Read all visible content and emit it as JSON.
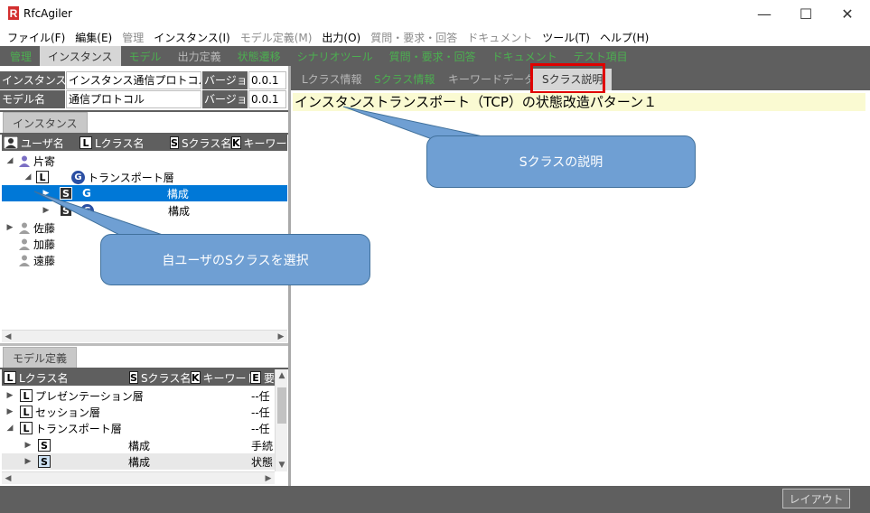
{
  "app": {
    "title": "RfcAgiler",
    "logo_letter": "R"
  },
  "window_controls": {
    "minimize": "—",
    "maximize": "☐",
    "close": "✕"
  },
  "menu": [
    {
      "label": "ファイル(F)",
      "enabled": true
    },
    {
      "label": "編集(E)",
      "enabled": true
    },
    {
      "label": "管理",
      "enabled": false
    },
    {
      "label": "インスタンス(I)",
      "enabled": true
    },
    {
      "label": "モデル定義(M)",
      "enabled": false
    },
    {
      "label": "出力(O)",
      "enabled": true
    },
    {
      "label": "質問・要求・回答",
      "enabled": false
    },
    {
      "label": "ドキュメント",
      "enabled": false
    },
    {
      "label": "ツール(T)",
      "enabled": true
    },
    {
      "label": "ヘルプ(H)",
      "enabled": true
    }
  ],
  "function_tabs": [
    {
      "label": "管理",
      "state": "green"
    },
    {
      "label": "インスタンス",
      "state": "active"
    },
    {
      "label": "モデル",
      "state": "green"
    },
    {
      "label": "出力定義",
      "state": "gray"
    },
    {
      "label": "状態遷移",
      "state": "green"
    },
    {
      "label": "シナリオツール",
      "state": "green"
    },
    {
      "label": "質問・要求・回答",
      "state": "green"
    },
    {
      "label": "ドキュメント",
      "state": "green"
    },
    {
      "label": "テスト項目",
      "state": "green"
    }
  ],
  "instance_form": {
    "instance_label": "インスタンス名",
    "instance_value": "インスタンス通信プロトコル",
    "model_label": "モデル名",
    "model_value": "通信プロトコル",
    "version_label": "バージョン",
    "instance_version": "0.0.1",
    "model_version": "0.0.1"
  },
  "instance_panel": {
    "tab_label": "インスタンス",
    "columns": [
      {
        "badge": "user",
        "label": "ユーザ名"
      },
      {
        "badge": "L",
        "label": "Lクラス名"
      },
      {
        "badge": "S",
        "label": "Sクラス名"
      },
      {
        "badge": "K",
        "label": "キーワード"
      }
    ],
    "tree": {
      "user_katayose": "片寄",
      "l_badge": "L",
      "g_badge": "G",
      "transport_layer": "トランスポート層",
      "s_badge": "S",
      "config": "構成",
      "user_sato": "佐藤",
      "user_kato": "加藤",
      "user_endo": "遠藤"
    }
  },
  "model_panel": {
    "tab_label": "モデル定義",
    "columns": [
      {
        "badge": "L",
        "label": "Lクラス名"
      },
      {
        "badge": "S",
        "label": "Sクラス名"
      },
      {
        "badge": "K",
        "label": "キーワード"
      },
      {
        "badge": "E",
        "label": "要"
      }
    ],
    "rows": [
      {
        "label": "プレゼンテーション層",
        "value": "--任"
      },
      {
        "label": "セッション層",
        "value": "--任"
      },
      {
        "label": "トランスポート層",
        "value": "--任"
      },
      {
        "label": "構成",
        "value": "手続"
      },
      {
        "label": "構成",
        "value": "状態"
      }
    ]
  },
  "right_tabs": [
    {
      "label": "Lクラス情報",
      "state": "gray"
    },
    {
      "label": "Sクラス情報",
      "state": "green"
    },
    {
      "label": "キーワードデータ",
      "state": "gray"
    },
    {
      "label": "Sクラス説明",
      "state": "active"
    }
  ],
  "content": {
    "title": "インスタンストランスポート（TCP）の状態改造パターン１"
  },
  "callouts": {
    "s_class_description": "Sクラスの説明",
    "select_own_s_class": "自ユーザのSクラスを選択"
  },
  "status": {
    "layout_button": "レイアウト"
  },
  "colors": {
    "highlight_border": "#e00000",
    "selection": "#0078d7",
    "callout_fill": "#6f9fd3",
    "tab_green": "#4caf50"
  }
}
